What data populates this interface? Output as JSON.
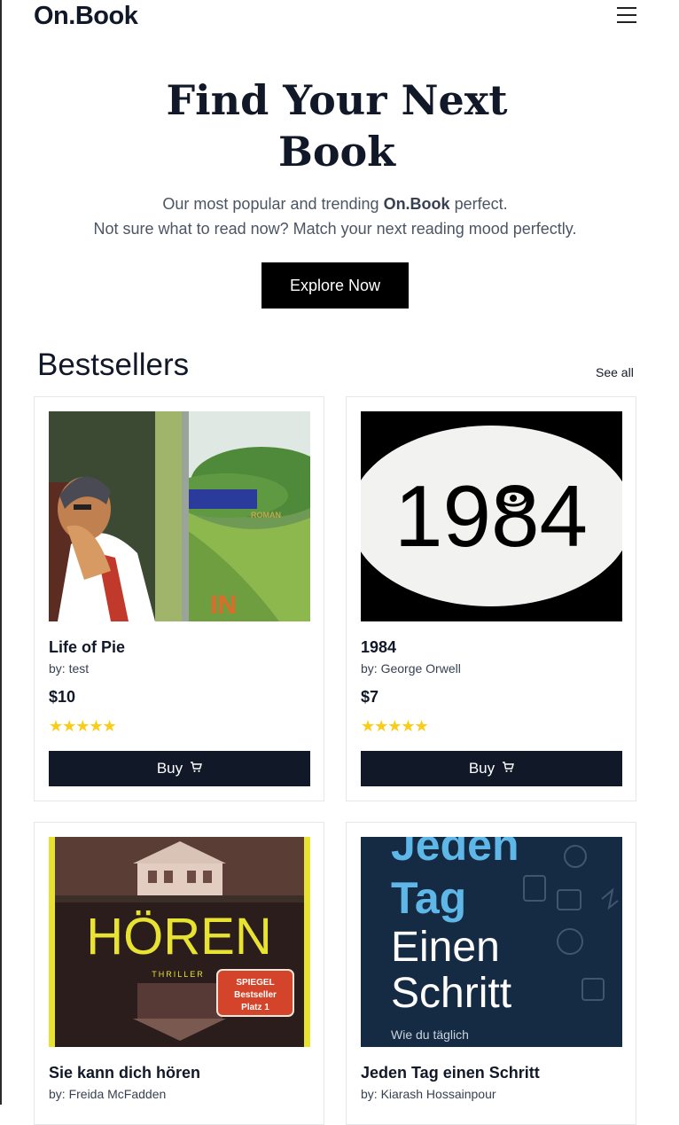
{
  "header": {
    "logo": "On.Book",
    "menu_icon": "hamburger-menu-icon"
  },
  "hero": {
    "title_line1": "Find Your Next",
    "title_line2": "Book",
    "sub1_pre": "Our most popular and trending ",
    "sub1_brand": "On.Book",
    "sub1_post": " perfect.",
    "sub2": "Not sure what to read now? Match your next reading mood perfectly.",
    "cta": "Explore Now"
  },
  "bestsellers": {
    "title": "Bestsellers",
    "see_all": "See all",
    "books": [
      {
        "title": "Life of Pie",
        "author": "by: test",
        "price": "$10",
        "stars": "★★★★★",
        "buy": "Buy",
        "cover": {
          "word1": "ROMAN",
          "word2": "IN"
        }
      },
      {
        "title": "1984",
        "author": "by: George Orwell",
        "price": "$7",
        "stars": "★★★★★",
        "buy": "Buy",
        "cover": {
          "word1": "1984"
        }
      },
      {
        "title": "Sie kann dich hören",
        "author": "by: Freida McFadden",
        "price": "",
        "stars": "",
        "buy": "",
        "cover": {
          "word1": "HÖREN",
          "word2": "THRILLER",
          "badge1": "SPIEGEL",
          "badge2": "Bestseller",
          "badge3": "Platz 1"
        }
      },
      {
        "title": "Jeden Tag einen Schritt",
        "author": "by: Kiarash Hossainpour",
        "price": "",
        "stars": "",
        "buy": "",
        "cover": {
          "word1": "Jeden",
          "word2": "Tag",
          "word3": "Einen",
          "word4": "Schritt",
          "word5": "Wie du täglich"
        }
      }
    ]
  },
  "colors": {
    "accent_dark": "#111827",
    "star": "#facc15",
    "cta_bg": "#000000"
  }
}
